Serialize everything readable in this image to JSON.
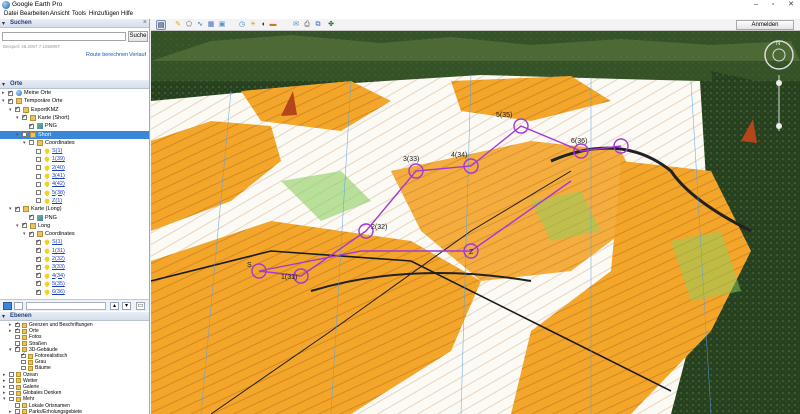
{
  "app": {
    "title": "Google Earth Pro"
  },
  "menu": [
    "Datei",
    "Bearbeiten",
    "Ansicht",
    "Tools",
    "Hinzufügen",
    "Hilfe"
  ],
  "search": {
    "header": "Suchen",
    "button": "Suche",
    "hint": "Beispiel: 46.2057,7.1058997",
    "route_link": "Route berechnen",
    "history_link": "Verlauf"
  },
  "places": {
    "header": "Orte",
    "items": [
      {
        "label": "Meine Orte",
        "level": 0,
        "expander": "▸",
        "checked": true,
        "icon": "globe-icon"
      },
      {
        "label": "Temporäre Orte",
        "level": 0,
        "expander": "▾",
        "checked": true,
        "icon": "folder-icon"
      },
      {
        "label": "ExportKMZ",
        "level": 1,
        "expander": "▾",
        "checked": true,
        "icon": "folder-icon"
      },
      {
        "label": "Karte (Short)",
        "level": 2,
        "expander": "▾",
        "checked": true,
        "icon": "folder-icon"
      },
      {
        "label": "PNG",
        "level": 3,
        "expander": "",
        "checked": true,
        "icon": "image-overlay-icon"
      },
      {
        "label": "Short",
        "level": 2,
        "expander": "▾",
        "checked": false,
        "icon": "folder-icon",
        "selected": true
      },
      {
        "label": "Coordinates",
        "level": 3,
        "expander": "▾",
        "checked": false,
        "icon": "folder-icon"
      },
      {
        "label": "S(1)",
        "level": 4,
        "expander": "",
        "checked": false,
        "icon": "pin-icon",
        "link": true
      },
      {
        "label": "1(39)",
        "level": 4,
        "expander": "",
        "checked": false,
        "icon": "pin-icon",
        "link": true
      },
      {
        "label": "2(40)",
        "level": 4,
        "expander": "",
        "checked": false,
        "icon": "pin-icon",
        "link": true
      },
      {
        "label": "3(41)",
        "level": 4,
        "expander": "",
        "checked": false,
        "icon": "pin-icon",
        "link": true
      },
      {
        "label": "4(42)",
        "level": 4,
        "expander": "",
        "checked": false,
        "icon": "pin-icon",
        "link": true
      },
      {
        "label": "5(38)",
        "level": 4,
        "expander": "",
        "checked": false,
        "icon": "pin-icon",
        "link": true
      },
      {
        "label": "Z(1)",
        "level": 4,
        "expander": "",
        "checked": false,
        "icon": "pin-icon",
        "link": true
      },
      {
        "label": "Karte (Long)",
        "level": 1,
        "expander": "▾",
        "checked": true,
        "icon": "folder-icon"
      },
      {
        "label": "PNG",
        "level": 3,
        "expander": "",
        "checked": true,
        "icon": "image-overlay-icon"
      },
      {
        "label": "Long",
        "level": 2,
        "expander": "▾",
        "checked": true,
        "icon": "folder-icon"
      },
      {
        "label": "Coordinates",
        "level": 3,
        "expander": "▾",
        "checked": true,
        "icon": "folder-icon"
      },
      {
        "label": "S(1)",
        "level": 4,
        "expander": "",
        "checked": true,
        "icon": "pin-icon",
        "link": true
      },
      {
        "label": "1(31)",
        "level": 4,
        "expander": "",
        "checked": true,
        "icon": "pin-icon",
        "link": true
      },
      {
        "label": "2(32)",
        "level": 4,
        "expander": "",
        "checked": true,
        "icon": "pin-icon",
        "link": true
      },
      {
        "label": "3(33)",
        "level": 4,
        "expander": "",
        "checked": true,
        "icon": "pin-icon",
        "link": true
      },
      {
        "label": "4(34)",
        "level": 4,
        "expander": "",
        "checked": true,
        "icon": "pin-icon",
        "link": true
      },
      {
        "label": "5(35)",
        "level": 4,
        "expander": "",
        "checked": true,
        "icon": "pin-icon",
        "link": true
      },
      {
        "label": "6(36)",
        "level": 4,
        "expander": "",
        "checked": true,
        "icon": "pin-icon",
        "link": true
      }
    ]
  },
  "layers": {
    "header": "Ebenen",
    "items": [
      {
        "label": "Grenzen und Beschriftungen",
        "level": 1,
        "checked": true,
        "expander": "▸"
      },
      {
        "label": "Orte",
        "level": 1,
        "checked": true,
        "expander": "▸"
      },
      {
        "label": "Fotos",
        "level": 1,
        "checked": false,
        "expander": ""
      },
      {
        "label": "Straßen",
        "level": 1,
        "checked": false,
        "expander": ""
      },
      {
        "label": "3D-Gebäude",
        "level": 1,
        "checked": true,
        "expander": "▾"
      },
      {
        "label": "Fotorealistisch",
        "level": 2,
        "checked": true,
        "expander": ""
      },
      {
        "label": "Grau",
        "level": 2,
        "checked": false,
        "expander": ""
      },
      {
        "label": "Bäume",
        "level": 2,
        "checked": false,
        "expander": ""
      },
      {
        "label": "Ozean",
        "level": 0,
        "checked": false,
        "expander": "▸"
      },
      {
        "label": "Wetter",
        "level": 0,
        "checked": false,
        "expander": "▸"
      },
      {
        "label": "Galerie",
        "level": 0,
        "checked": false,
        "expander": "▸"
      },
      {
        "label": "Globales Denken",
        "level": 0,
        "checked": false,
        "expander": "▸"
      },
      {
        "label": "Mehr",
        "level": 0,
        "checked": false,
        "expander": "▾"
      },
      {
        "label": "Lokale Ortsnamen",
        "level": 1,
        "checked": false,
        "expander": ""
      },
      {
        "label": "Parks/Erholungsgebiete",
        "level": 1,
        "checked": false,
        "expander": "▸"
      }
    ]
  },
  "toolbar": {
    "signin": "Anmelden"
  },
  "map": {
    "controls": [
      "N"
    ],
    "labels": [
      "1(31)",
      "2(32)",
      "3(33)",
      "4(34)",
      "5(35)",
      "6(36)",
      "S",
      "Z"
    ]
  },
  "colors": {
    "accent": "#3a87d8",
    "orange_terrain": "#f4a62a",
    "course_line": "#a438d6",
    "forest": "#2e4a22"
  }
}
